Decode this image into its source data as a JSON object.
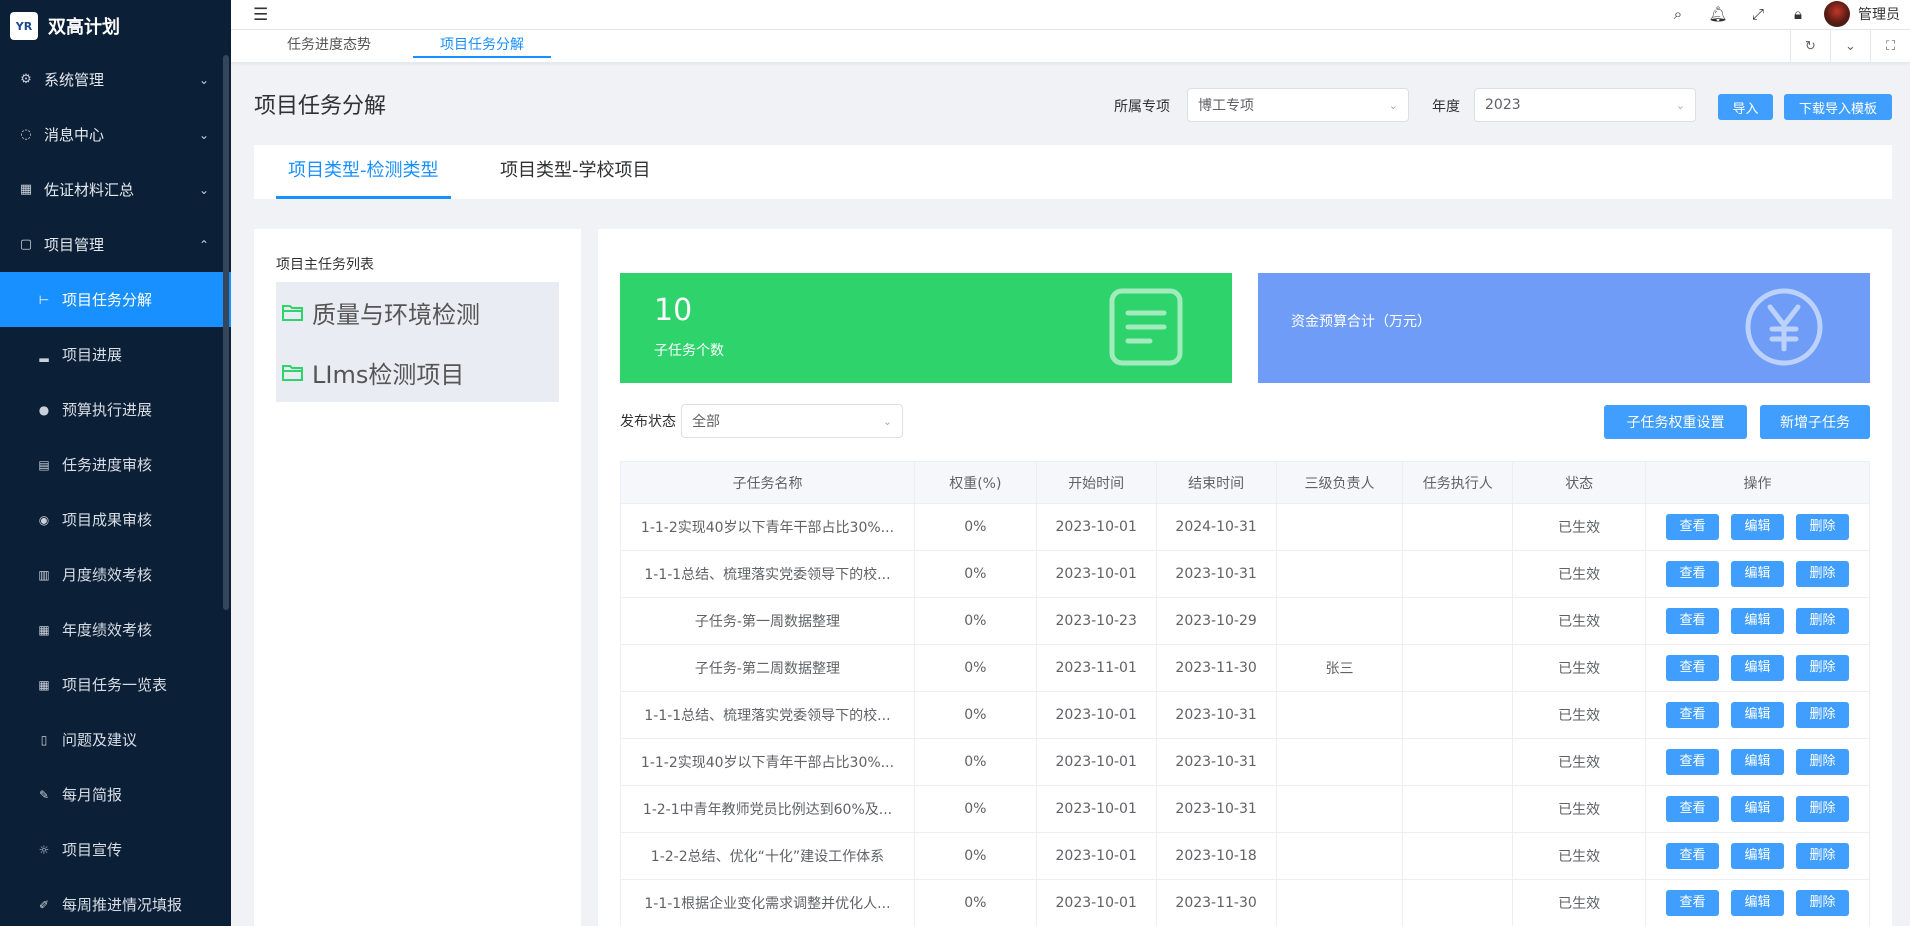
{
  "app": {
    "title": "双高计划",
    "logo_text": "YR"
  },
  "sidebar": {
    "groups": [
      {
        "label": "系统管理",
        "icon": "gear-icon"
      },
      {
        "label": "消息中心",
        "icon": "chat-icon"
      },
      {
        "label": "佐证材料汇总",
        "icon": "grid-icon"
      },
      {
        "label": "项目管理",
        "icon": "clipboard-icon"
      }
    ],
    "items": [
      {
        "label": "项目任务分解",
        "icon": "split-icon"
      },
      {
        "label": "项目进展",
        "icon": "bar-chart-icon"
      },
      {
        "label": "预算执行进展",
        "icon": "clock-icon"
      },
      {
        "label": "任务进度审核",
        "icon": "document-icon"
      },
      {
        "label": "项目成果审核",
        "icon": "medal-icon"
      },
      {
        "label": "月度绩效考核",
        "icon": "calendar-icon"
      },
      {
        "label": "年度绩效考核",
        "icon": "table-icon"
      },
      {
        "label": "项目任务一览表",
        "icon": "list-table-icon"
      },
      {
        "label": "问题及建议",
        "icon": "phone-icon"
      },
      {
        "label": "每月简报",
        "icon": "edit-icon"
      },
      {
        "label": "项目宣传",
        "icon": "bulb-icon"
      },
      {
        "label": "每周推进情况填报",
        "icon": "pen-icon"
      }
    ]
  },
  "header": {
    "admin_name": "管理员"
  },
  "tabs": [
    "任务进度态势",
    "项目任务分解"
  ],
  "page": {
    "title": "项目任务分解",
    "filter_special_label": "所属专项",
    "filter_special_value": "博工专项",
    "filter_year_label": "年度",
    "filter_year_value": "2023",
    "import_label": "导入",
    "download_label": "下载导入模板"
  },
  "type_tabs": [
    "项目类型-检测类型",
    "项目类型-学校项目"
  ],
  "left": {
    "title": "项目主任务列表",
    "tasks": [
      "质量与环境检测",
      "LIms检测项目"
    ]
  },
  "stats": {
    "subtask_count": "10",
    "subtask_caption": "子任务个数",
    "budget_caption": "资金预算合计（万元）"
  },
  "toolbar": {
    "status_label": "发布状态",
    "status_value": "全部",
    "weight_btn": "子任务权重设置",
    "add_btn": "新增子任务"
  },
  "table": {
    "columns": [
      "子任务名称",
      "权重(%)",
      "开始时间",
      "结束时间",
      "三级负责人",
      "任务执行人",
      "状态",
      "操作"
    ],
    "actions": [
      "查看",
      "编辑",
      "删除"
    ],
    "rows": [
      [
        "1-1-2实现40岁以下青年干部占比30%...",
        "0%",
        "2023-10-01",
        "2024-10-31",
        "",
        "",
        "已生效"
      ],
      [
        "1-1-1总结、梳理落实党委领导下的校...",
        "0%",
        "2023-10-01",
        "2023-10-31",
        "",
        "",
        "已生效"
      ],
      [
        "子任务-第一周数据整理",
        "0%",
        "2023-10-23",
        "2023-10-29",
        "",
        "",
        "已生效"
      ],
      [
        "子任务-第二周数据整理",
        "0%",
        "2023-11-01",
        "2023-11-30",
        "张三",
        "",
        "已生效"
      ],
      [
        "1-1-1总结、梳理落实党委领导下的校...",
        "0%",
        "2023-10-01",
        "2023-10-31",
        "",
        "",
        "已生效"
      ],
      [
        "1-1-2实现40岁以下青年干部占比30%...",
        "0%",
        "2023-10-01",
        "2023-10-31",
        "",
        "",
        "已生效"
      ],
      [
        "1-2-1中青年教师党员比例达到60%及...",
        "0%",
        "2023-10-01",
        "2023-10-31",
        "",
        "",
        "已生效"
      ],
      [
        "1-2-2总结、优化“十化”建设工作体系",
        "0%",
        "2023-10-01",
        "2023-10-18",
        "",
        "",
        "已生效"
      ],
      [
        "1-1-1根据企业变化需求调整并优化人...",
        "0%",
        "2023-10-01",
        "2023-11-30",
        "",
        "",
        "已生效"
      ]
    ]
  }
}
